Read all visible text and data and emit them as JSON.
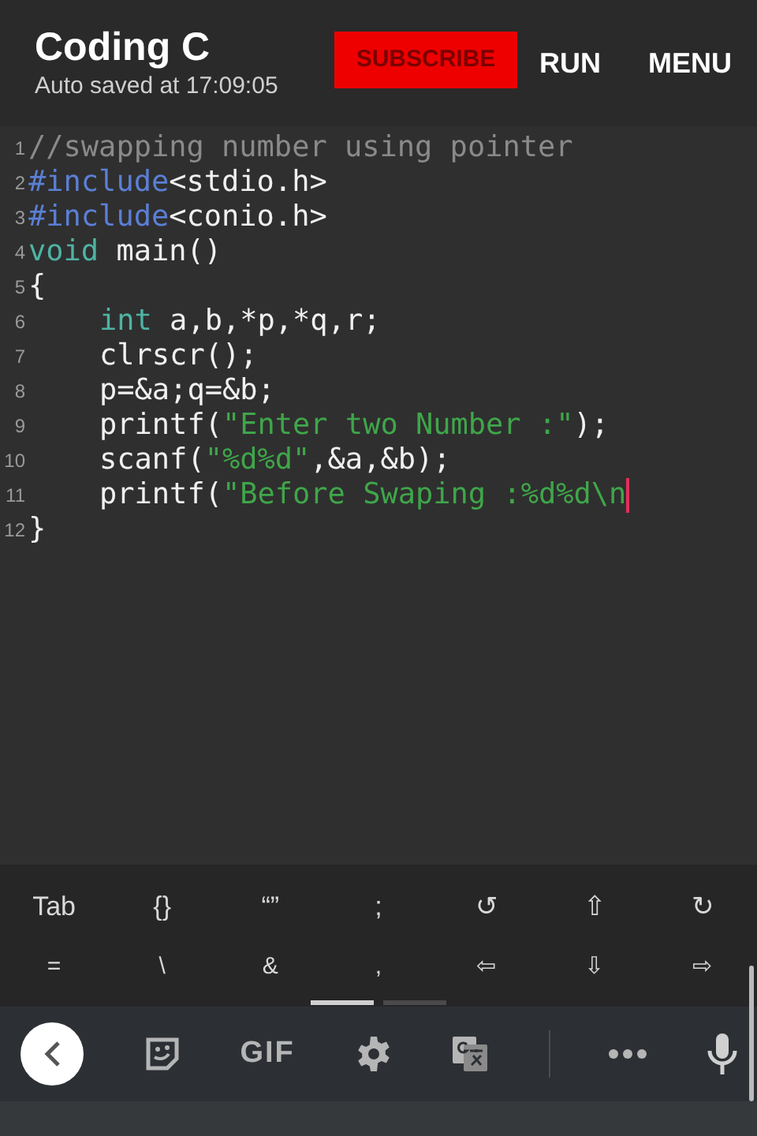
{
  "header": {
    "title": "Coding C",
    "subtitle": "Auto saved at 17:09:05",
    "subscribe_badge": "SUBSCRIBE",
    "actions": [
      "RUN",
      "MENU"
    ]
  },
  "editor": {
    "lines": [
      {
        "number": "1",
        "indented": false,
        "cursor": false,
        "segments": [
          {
            "kind": "comment",
            "text": "//swapping number using pointer"
          }
        ]
      },
      {
        "number": "2",
        "indented": false,
        "cursor": false,
        "segments": [
          {
            "kind": "directive",
            "text": "#include"
          },
          {
            "kind": "plain",
            "text": "<stdio.h>"
          }
        ]
      },
      {
        "number": "3",
        "indented": false,
        "cursor": false,
        "segments": [
          {
            "kind": "directive",
            "text": "#include"
          },
          {
            "kind": "plain",
            "text": "<conio.h>"
          }
        ]
      },
      {
        "number": "4",
        "indented": false,
        "cursor": false,
        "segments": [
          {
            "kind": "keyword",
            "text": "void"
          },
          {
            "kind": "plain",
            "text": " main()"
          }
        ]
      },
      {
        "number": "5",
        "indented": false,
        "cursor": false,
        "segments": [
          {
            "kind": "plain",
            "text": "{"
          }
        ]
      },
      {
        "number": "6",
        "indented": true,
        "cursor": false,
        "segments": [
          {
            "kind": "keyword",
            "text": "int"
          },
          {
            "kind": "plain",
            "text": " a,b,*p,*q,r;"
          }
        ]
      },
      {
        "number": "7",
        "indented": true,
        "cursor": false,
        "segments": [
          {
            "kind": "plain",
            "text": "clrscr();"
          }
        ]
      },
      {
        "number": "8",
        "indented": true,
        "cursor": false,
        "segments": [
          {
            "kind": "plain",
            "text": "p=&a;q=&b;"
          }
        ]
      },
      {
        "number": "9",
        "indented": true,
        "cursor": false,
        "segments": [
          {
            "kind": "plain",
            "text": "printf("
          },
          {
            "kind": "string",
            "text": "\"Enter two Number :\""
          },
          {
            "kind": "plain",
            "text": ");"
          }
        ]
      },
      {
        "number": "10",
        "indented": true,
        "cursor": false,
        "segments": [
          {
            "kind": "plain",
            "text": "scanf("
          },
          {
            "kind": "string",
            "text": "\"%d%d\""
          },
          {
            "kind": "plain",
            "text": ",&a,&b);"
          }
        ]
      },
      {
        "number": "11",
        "indented": true,
        "cursor": true,
        "segments": [
          {
            "kind": "plain",
            "text": "printf("
          },
          {
            "kind": "string",
            "text": "\"Before Swaping :%d%d\\n"
          }
        ]
      },
      {
        "number": "12",
        "indented": false,
        "cursor": false,
        "segments": [
          {
            "kind": "plain",
            "text": "}"
          }
        ]
      }
    ]
  },
  "extra_keys": [
    [
      "Tab",
      "{}",
      "“”",
      ";",
      "↺",
      "⇧",
      "↻"
    ],
    [
      "=",
      "\\",
      "&",
      ",",
      "⇦",
      "⇩",
      "⇨"
    ]
  ],
  "page_indicator": [
    {
      "selected": true
    },
    {
      "selected": false
    }
  ],
  "keyboard_toolbar": [
    {
      "kind": "back"
    },
    {
      "kind": "sticker"
    },
    {
      "kind": "gif",
      "label": "GIF"
    },
    {
      "kind": "settings"
    },
    {
      "kind": "translate"
    },
    {
      "kind": "divider"
    },
    {
      "kind": "more"
    },
    {
      "kind": "mic"
    }
  ]
}
